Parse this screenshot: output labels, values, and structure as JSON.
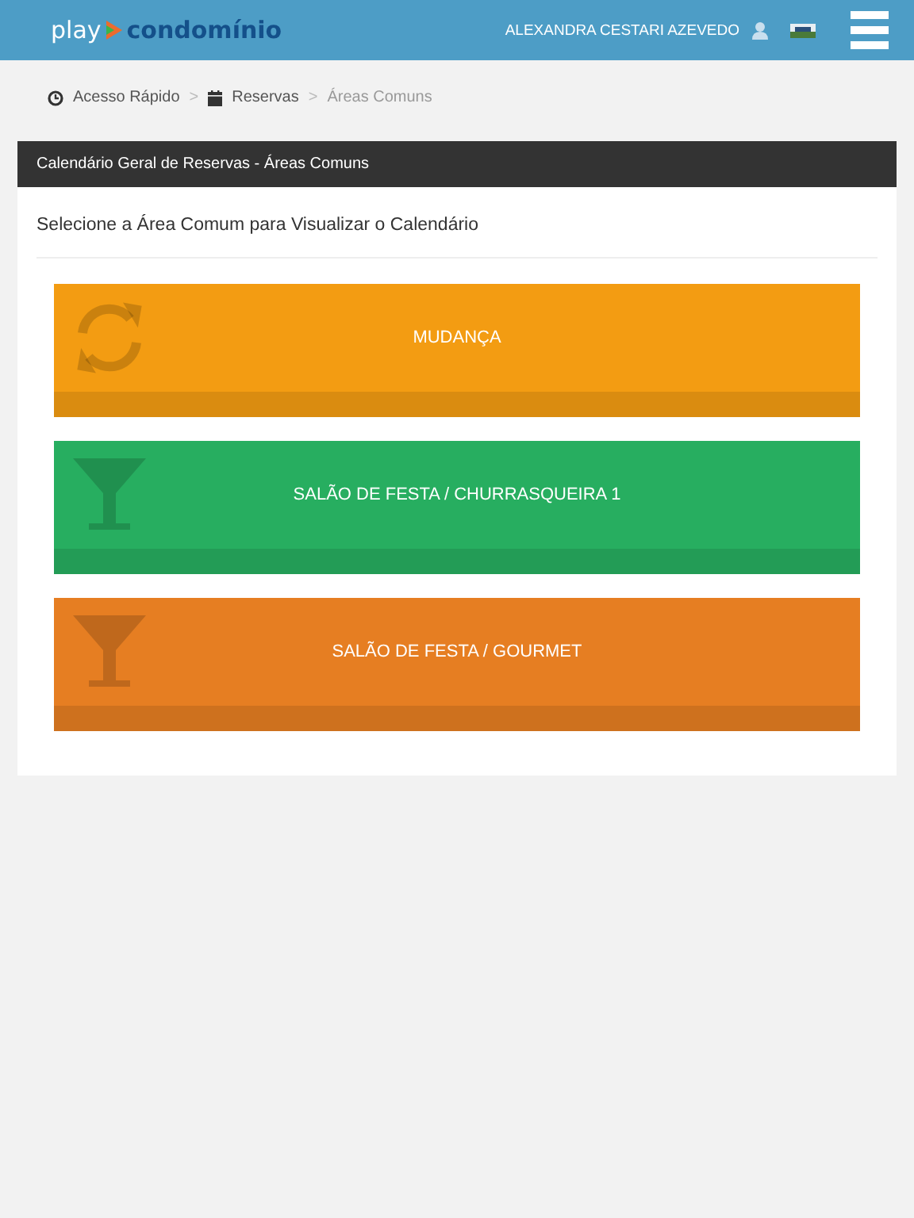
{
  "header": {
    "logo_left": "play",
    "logo_right": "condomínio",
    "user_name": "ALEXANDRA CESTARI AZEVEDO"
  },
  "breadcrumb": [
    {
      "label": "Acesso Rápido",
      "kind": "clock"
    },
    {
      "separator": ">",
      "label": "Reservas",
      "kind": "calendar"
    },
    {
      "separator": ">",
      "label": "Áreas Comuns"
    }
  ],
  "panel": {
    "title": "Calendário Geral de Reservas - Áreas Comuns",
    "prompt": "Selecione a Área Comum para Visualizar o Calendário",
    "areas": [
      {
        "label": "MUDANÇA",
        "kind": "refresh",
        "color": "#f39c12"
      },
      {
        "label": "SALÃO DE FESTA / CHURRASQUEIRA 1",
        "kind": "glass",
        "color": "#27ae60"
      },
      {
        "label": "SALÃO DE FESTA / GOURMET",
        "kind": "glass",
        "color": "#e67e22"
      }
    ]
  }
}
